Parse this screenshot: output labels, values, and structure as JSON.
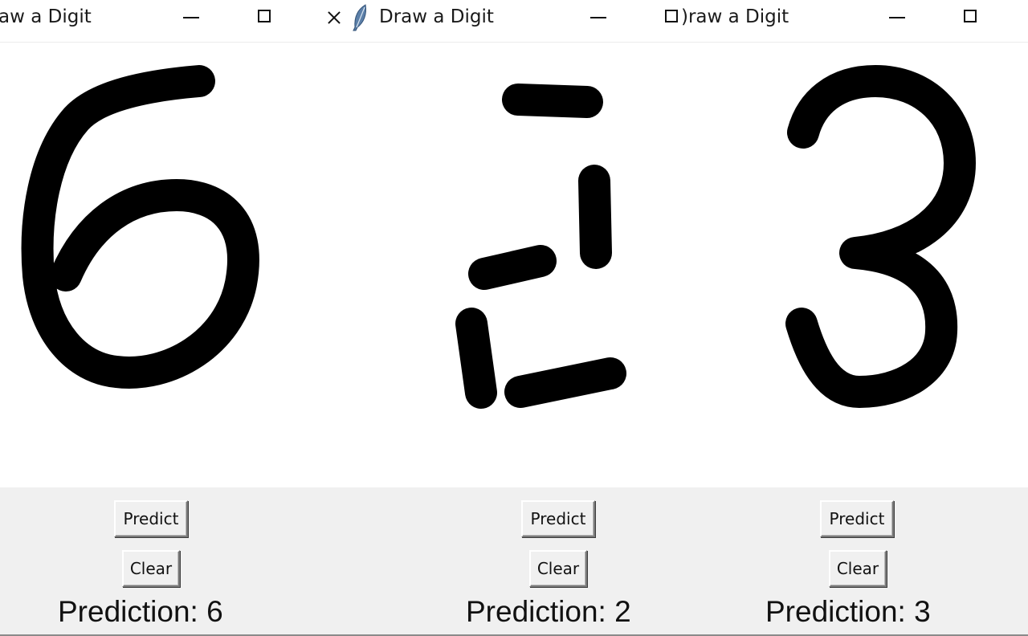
{
  "windows": [
    {
      "title": "aw a Digit",
      "predict_label": "Predict",
      "clear_label": "Clear",
      "prediction_text": "Prediction: 6",
      "drawn_digit": "6"
    },
    {
      "title": "Draw a Digit",
      "predict_label": "Predict",
      "clear_label": "Clear",
      "prediction_text": "Prediction: 2",
      "drawn_digit": "2"
    },
    {
      "title": ")raw a Digit",
      "predict_label": "Predict",
      "clear_label": "Clear",
      "prediction_text": "Prediction: 3",
      "drawn_digit": "3"
    }
  ],
  "icons": {
    "app_icon": "feather-icon",
    "window_controls": [
      "minimize-icon",
      "maximize-icon",
      "close-icon"
    ]
  },
  "colors": {
    "stroke": "#000000",
    "canvas_bg": "#ffffff",
    "panel_bg": "#f0f0f0"
  }
}
